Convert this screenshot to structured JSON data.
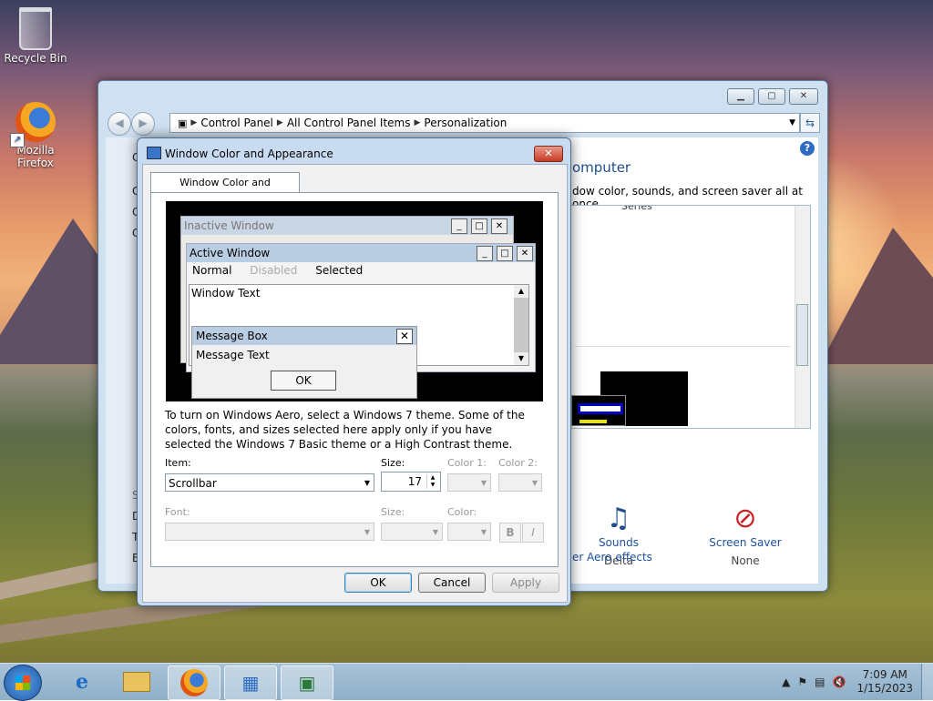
{
  "desktop": {
    "icons": [
      {
        "label": "Recycle Bin",
        "icon": "recycle-bin-icon"
      },
      {
        "label": "Mozilla Firefox",
        "icon": "firefox-icon"
      }
    ]
  },
  "control_panel": {
    "breadcrumb": [
      "Control Panel",
      "All Control Panel Items",
      "Personalization"
    ],
    "left_letters": [
      "C",
      "C",
      "C",
      "C",
      "S",
      "D",
      "T",
      "E"
    ],
    "title_partial": "omputer",
    "desc_partial": "dow color, sounds, and screen saver all at once.",
    "scroll_label_partial": "Series",
    "sounds": {
      "name": "Sounds",
      "value": "Delta"
    },
    "screensaver": {
      "name": "Screen Saver",
      "value": "None"
    },
    "aero_link_partial": "er Aero effects"
  },
  "dialog": {
    "title": "Window Color and Appearance",
    "tab": "Window Color and Appearance",
    "preview": {
      "inactive": "Inactive Window",
      "active": "Active Window",
      "menu": {
        "normal": "Normal",
        "disabled": "Disabled",
        "selected": "Selected"
      },
      "window_text": "Window Text",
      "msgbox_title": "Message Box",
      "msgbox_text": "Message Text",
      "msgbox_ok": "OK"
    },
    "info": "To turn on Windows Aero, select a Windows 7 theme.  Some of the colors, fonts, and sizes selected here apply only if you have selected the Windows 7 Basic theme or a High Contrast theme.",
    "item_label": "Item:",
    "item_value": "Scrollbar",
    "size_label": "Size:",
    "size_value": "17",
    "color1_label": "Color 1:",
    "color2_label": "Color 2:",
    "font_label": "Font:",
    "font_size_label": "Size:",
    "font_color_label": "Color:",
    "bold": "B",
    "italic": "I",
    "ok": "OK",
    "cancel": "Cancel",
    "apply": "Apply"
  },
  "taskbar": {
    "time": "7:09 AM",
    "date": "1/15/2023"
  }
}
